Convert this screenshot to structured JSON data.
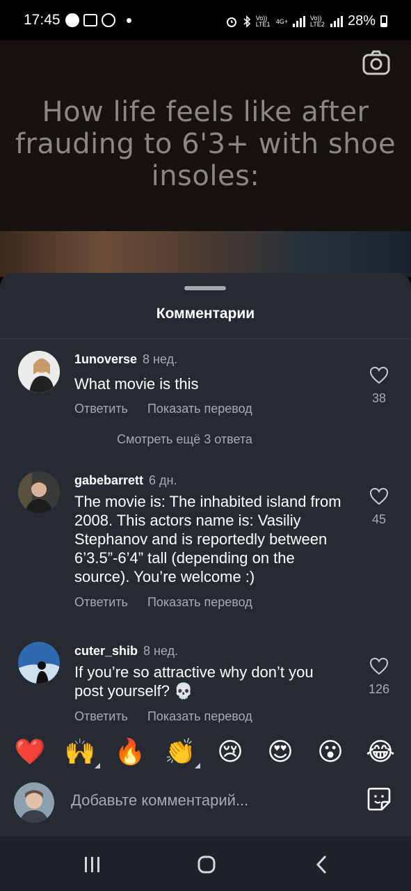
{
  "status_bar": {
    "time": "17:45",
    "battery": "28%",
    "net1": "Vo)) LTE1",
    "net2": "4G+",
    "net3": "Vo)) LTE2"
  },
  "video": {
    "caption": "How life feels like after frauding to 6'3+ with shoe insoles:",
    "camera_icon": "camera-icon"
  },
  "sheet": {
    "title": "Комментарии"
  },
  "comments": [
    {
      "username": "1unoverse",
      "time": "8 нед.",
      "text": "What movie is this",
      "reply": "Ответить",
      "translate": "Показать перевод",
      "likes": "38"
    },
    {
      "username": "gabebarrett",
      "time": "6 дн.",
      "text": "The movie is: The inhabited island from 2008. This actors name is: Vasiliy Stephanov and is reportedly between 6’3.5”-6’4” tall (depending on the source). You’re welcome :)",
      "reply": "Ответить",
      "translate": "Показать перевод",
      "likes": "45"
    },
    {
      "username": "cuter_shib",
      "time": "8 нед.",
      "text": "If you’re so attractive why don’t you post yourself? 💀",
      "reply": "Ответить",
      "translate": "Показать перевод",
      "likes": "126"
    }
  ],
  "more_replies": "Смотреть ещё 3 ответа",
  "emojis": [
    "❤️",
    "🙌",
    "🔥",
    "👏",
    "😢",
    "😍",
    "😮",
    "😂"
  ],
  "composer": {
    "placeholder": "Добавьте комментарий...",
    "sticker_icon": "sticker-icon"
  },
  "nav": {
    "recents": "recents-icon",
    "home": "home-icon",
    "back": "back-icon"
  }
}
